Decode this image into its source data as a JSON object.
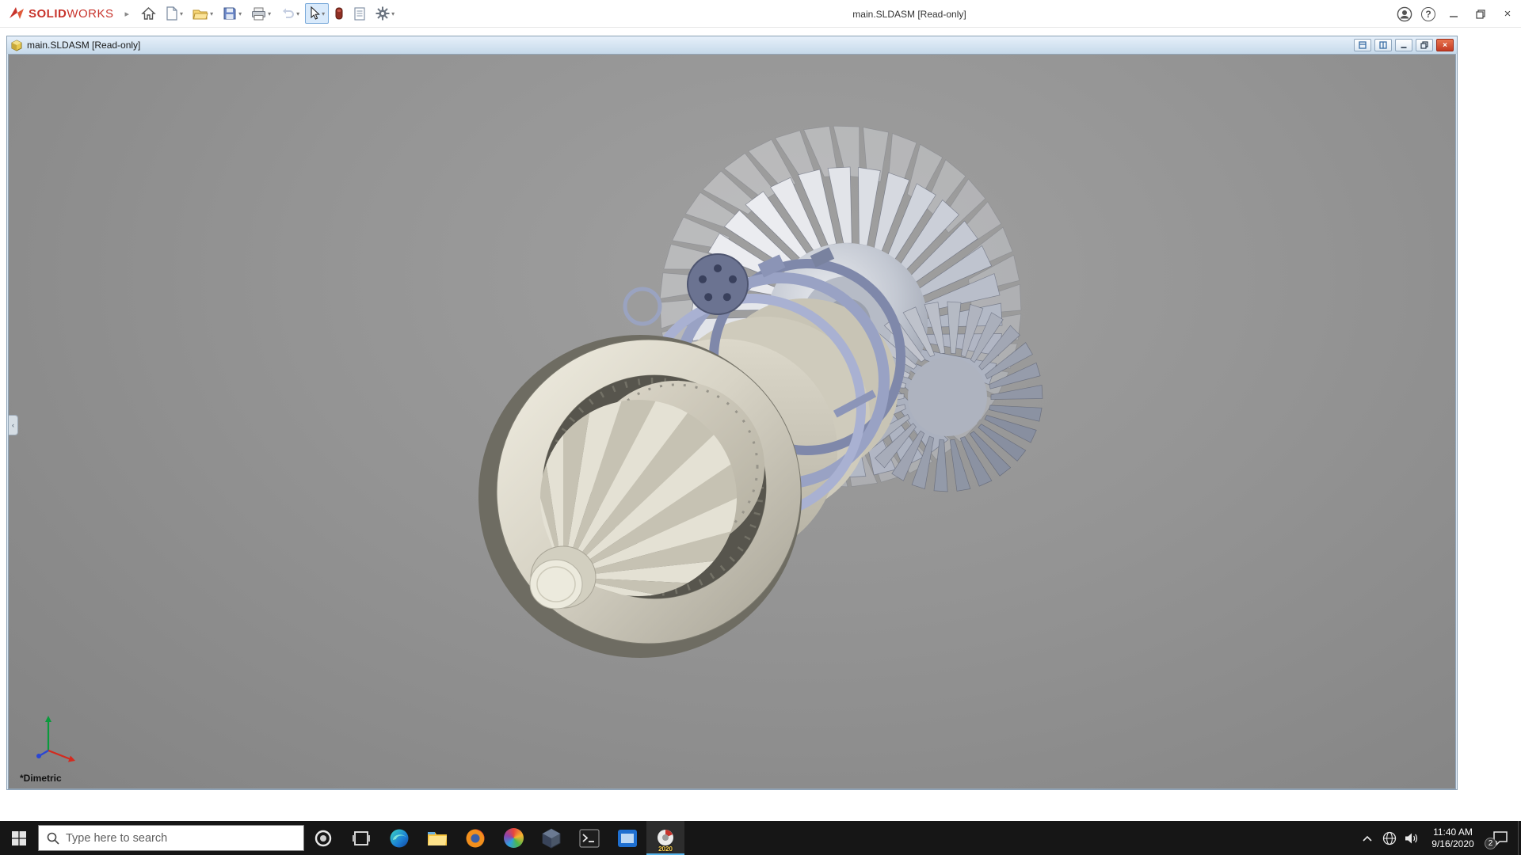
{
  "app": {
    "title": "main.SLDASM [Read-only]",
    "logo_bold": "SOLID",
    "logo_light": "WORKS"
  },
  "toolbar": {
    "icons": [
      "home-icon",
      "new-document-icon",
      "open-folder-icon",
      "save-icon",
      "print-icon",
      "undo-icon",
      "select-cursor-icon",
      "apps-icon",
      "report-sheet-icon",
      "options-gear-icon",
      "user-account-icon",
      "help-icon",
      "minimize-icon",
      "maximize-icon",
      "close-icon"
    ]
  },
  "document": {
    "title": "main.SLDASM [Read-only]",
    "view_orientation": "*Dimetric"
  },
  "taskbar": {
    "search_placeholder": "Type here to search",
    "time": "11:40 AM",
    "date": "9/16/2020",
    "notification_count": "2",
    "solidworks_year": "2020",
    "app_icons": [
      "start-icon",
      "cortana-icon",
      "task-view-icon",
      "edge-icon",
      "file-explorer-icon",
      "firefox-icon",
      "colorful-ball-icon",
      "cube-app-icon",
      "terminal-icon",
      "blue-app-icon",
      "solidworks-icon",
      "chevron-up-icon",
      "network-globe-icon",
      "speaker-icon",
      "action-center-icon"
    ]
  },
  "colors": {
    "brand_red": "#c8342c",
    "doc_titlebar": "#cfe0ef",
    "viewport_gray": "#949494",
    "model_cream": "#d6d2c4",
    "model_lavender": "#9aa3c4",
    "taskbar_dark": "#161616"
  }
}
